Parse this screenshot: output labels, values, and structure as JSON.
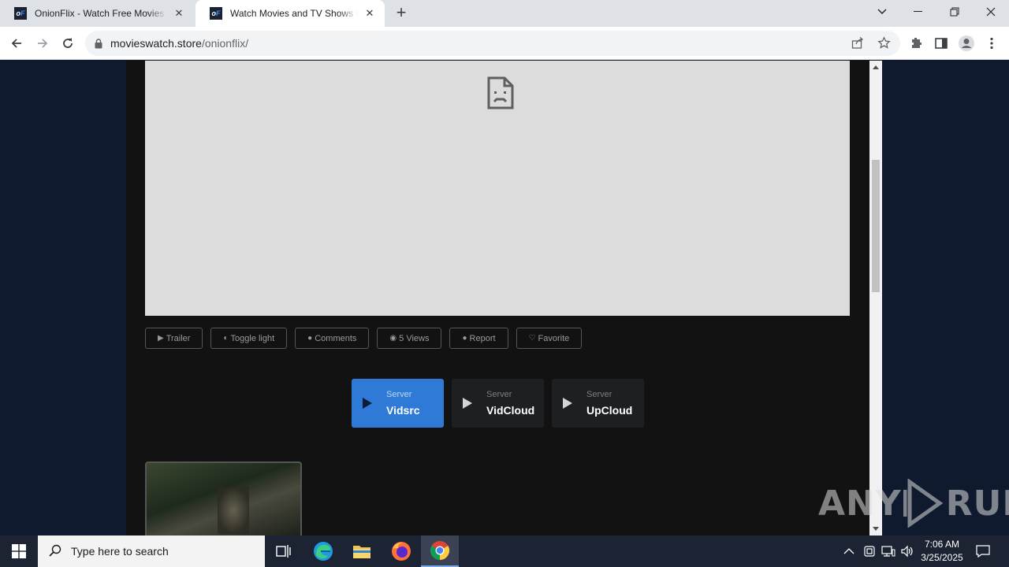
{
  "browser": {
    "tabs": [
      {
        "title": "OnionFlix - Watch Free Movies & TV",
        "active": false
      },
      {
        "title": "Watch Movies and TV Shows Online",
        "active": true
      }
    ],
    "new_tab_label": "+",
    "address": {
      "domain": "movieswatch.store",
      "path": "/onionflix/"
    }
  },
  "page": {
    "action_buttons": [
      {
        "icon": "youtube-icon",
        "label": "Trailer"
      },
      {
        "icon": "adjust-icon",
        "label": "Toggle light"
      },
      {
        "icon": "comment-icon",
        "label": "Comments"
      },
      {
        "icon": "eye-icon",
        "label": "5 Views"
      },
      {
        "icon": "alert-icon",
        "label": "Report"
      },
      {
        "icon": "heart-icon",
        "label": "Favorite"
      }
    ],
    "servers": [
      {
        "label": "Server",
        "name": "Vidsrc",
        "active": true
      },
      {
        "label": "Server",
        "name": "VidCloud",
        "active": false
      },
      {
        "label": "Server",
        "name": "UpCloud",
        "active": false
      }
    ],
    "colors": {
      "active_server": "#2f7ad6",
      "content_bg": "#121212",
      "page_bg": "#0f1a2e"
    }
  },
  "watermark": {
    "text_left": "ANY",
    "text_right": "RUN"
  },
  "taskbar": {
    "search_placeholder": "Type here to search",
    "time": "7:06 AM",
    "date": "3/25/2025"
  }
}
